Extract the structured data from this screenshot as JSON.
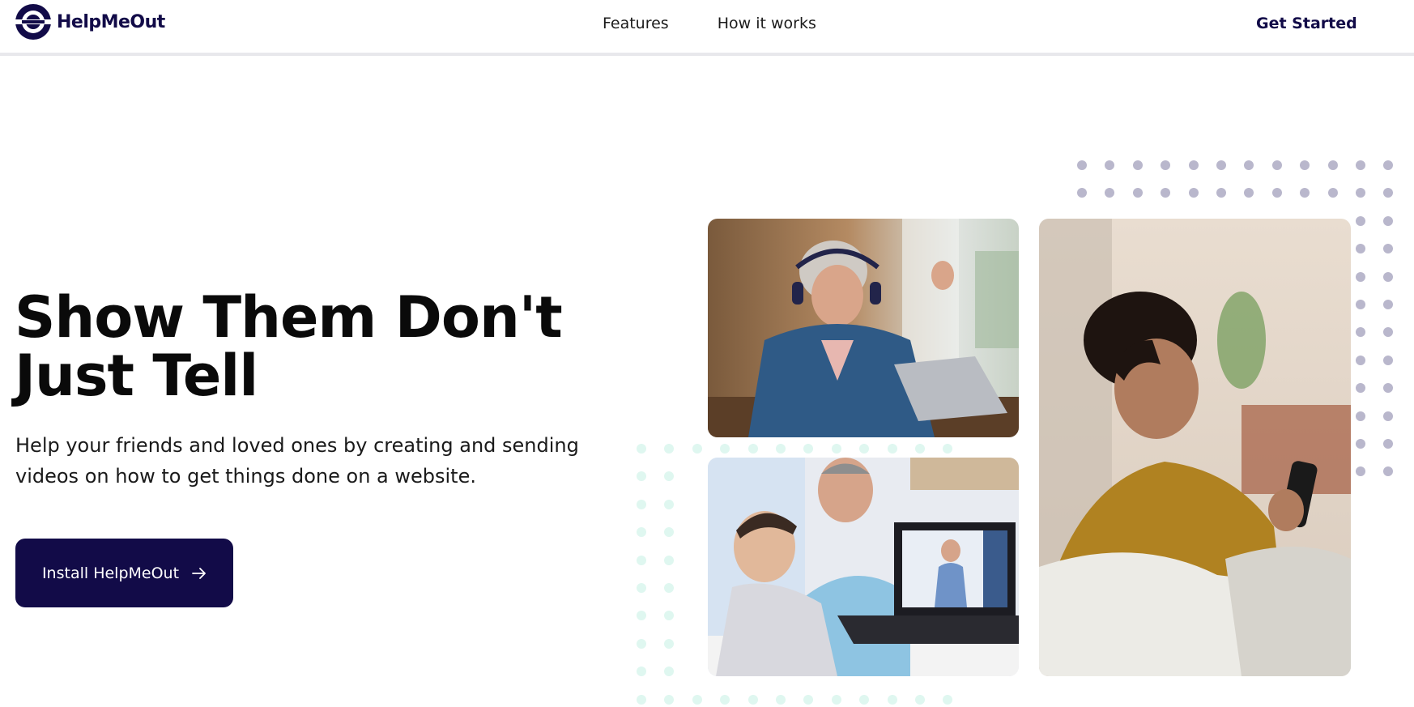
{
  "header": {
    "brand_name": "HelpMeOut",
    "nav": [
      {
        "label": "Features"
      },
      {
        "label": "How it works"
      }
    ],
    "cta_label": "Get Started"
  },
  "hero": {
    "headline_line1": "Show Them Don't",
    "headline_line2": "Just Tell",
    "subtext_line1": "Help your friends and loved ones by creating and sending",
    "subtext_line2": "videos on how to get things done on a website.",
    "install_label": "Install HelpMeOut",
    "install_icon": "arrow-right-icon"
  },
  "images": [
    {
      "name": "photo-woman-headphones-laptop"
    },
    {
      "name": "photo-man-boy-laptop"
    },
    {
      "name": "photo-woman-smiling-phone"
    }
  ],
  "colors": {
    "brand": "#120b48",
    "dots_purple": "#b9b7cc",
    "dots_teal": "#dff7f0"
  }
}
